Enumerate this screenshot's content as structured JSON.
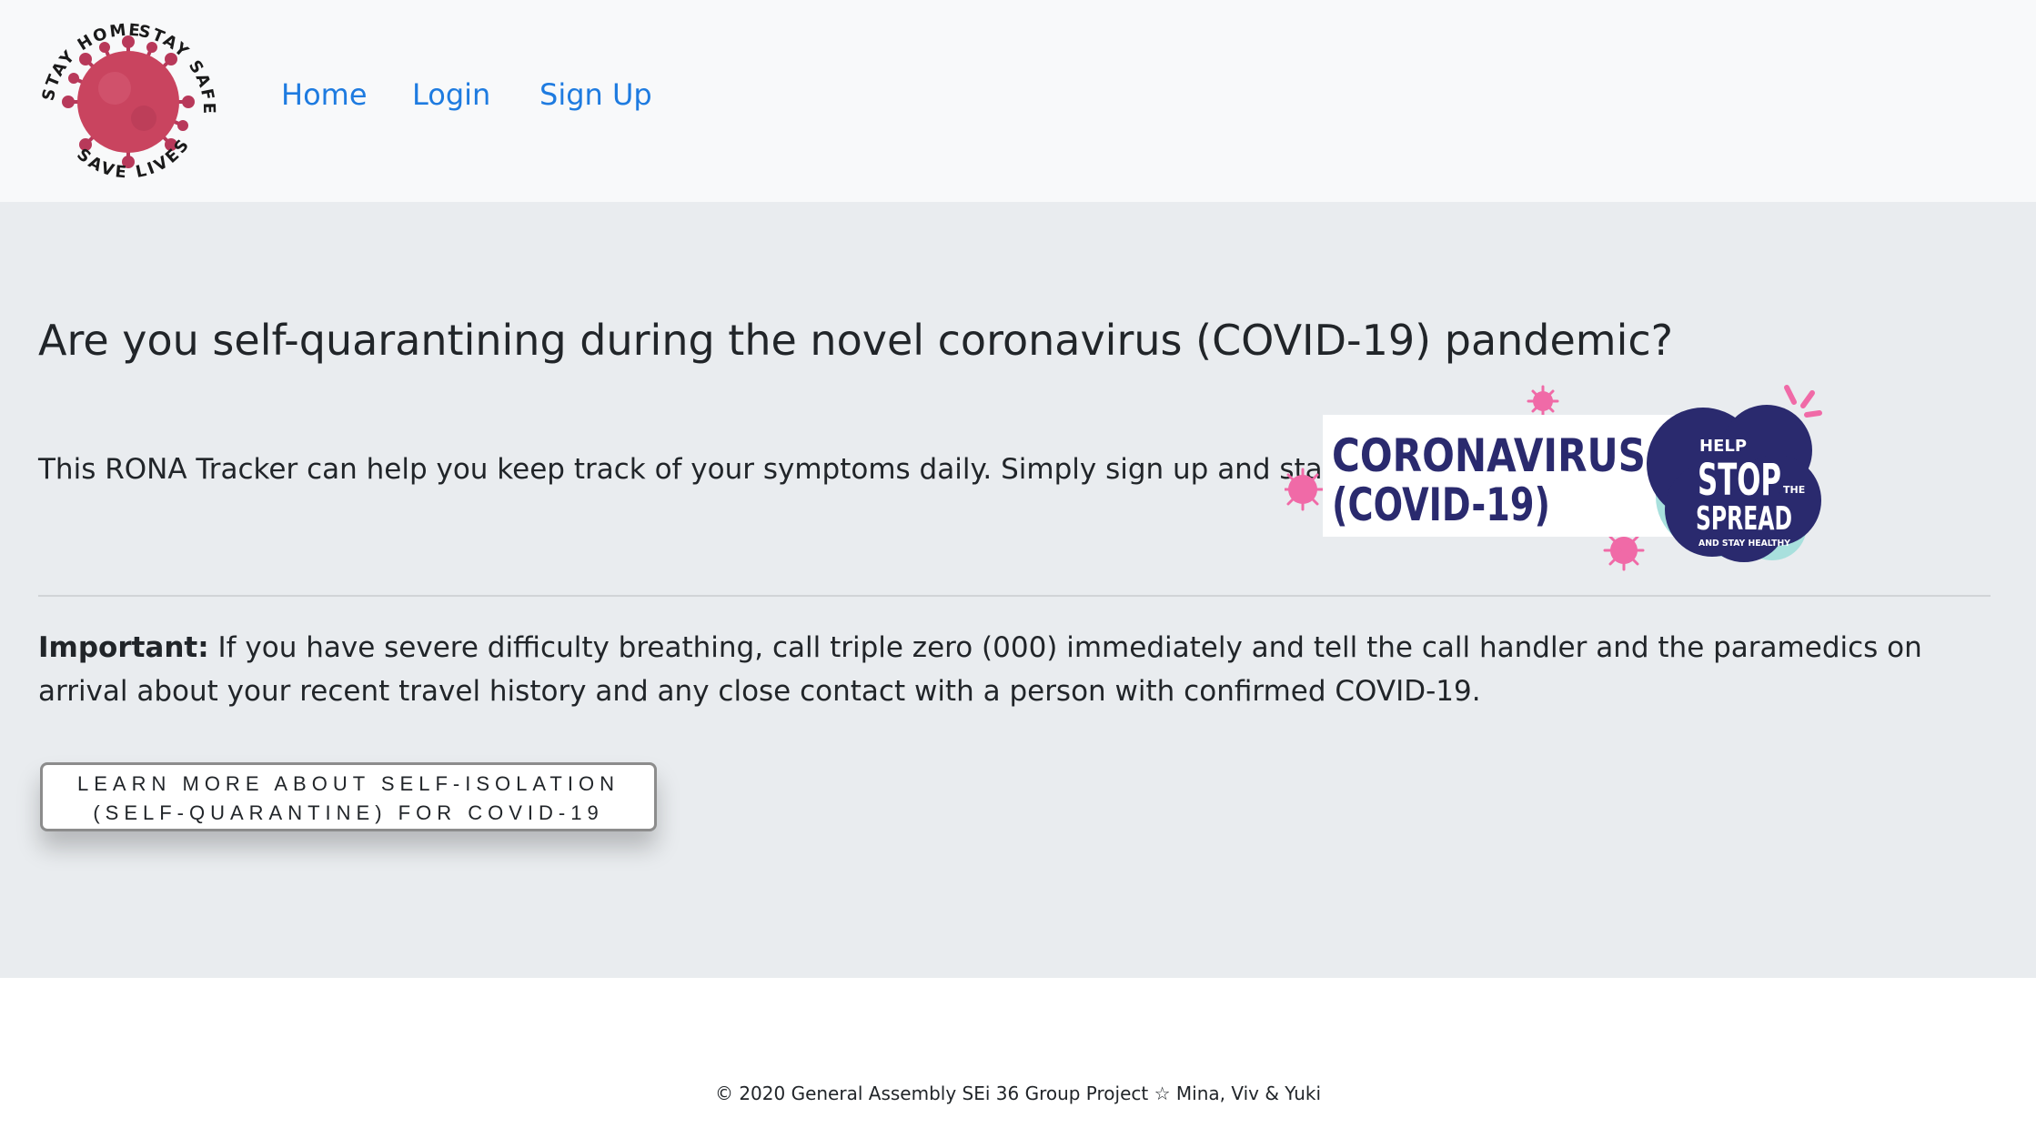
{
  "logo": {
    "text_top_left": "STAY HOME",
    "text_top_right": "STAY SAFE",
    "text_bottom": "SAVE LIVES"
  },
  "nav": {
    "items": [
      {
        "label": "Home"
      },
      {
        "label": "Login"
      },
      {
        "label": "Sign Up"
      }
    ]
  },
  "main": {
    "headline": "Are you self-quarantining during the novel coronavirus (COVID-19) pandemic?",
    "lead": "This RONA Tracker can help you keep track of your symptoms daily. Simply sign up and start tracking.",
    "banner": {
      "line1": "CORONAVIRUS",
      "line2": "(COVID-19)",
      "badge_help": "HELP",
      "badge_stop": "STOP",
      "badge_the": "THE",
      "badge_spread": "SPREAD",
      "badge_sub": "AND STAY HEALTHY"
    },
    "important_label": "Important:",
    "important_text": " If you have severe difficulty breathing, call triple zero (000) immediately and tell the call handler and the paramedics on arrival about your recent travel history and any close contact with a person with confirmed COVID-19.",
    "learn_button": "LEARN MORE ABOUT SELF-ISOLATION (SELF-QUARANTINE) FOR COVID-19"
  },
  "footer": {
    "text": "© 2020 General Assembly SEi 36 Group Project ☆ Mina, Viv & Yuki"
  },
  "colors": {
    "nav_link": "#1e7be0",
    "navbar_bg": "#f8f9fa",
    "jumbotron_bg": "#e9ecef",
    "virus": "#c9445f",
    "banner_navy": "#2a2a6e",
    "banner_pink": "#f06aa7",
    "banner_teal": "#a8e0dd"
  }
}
